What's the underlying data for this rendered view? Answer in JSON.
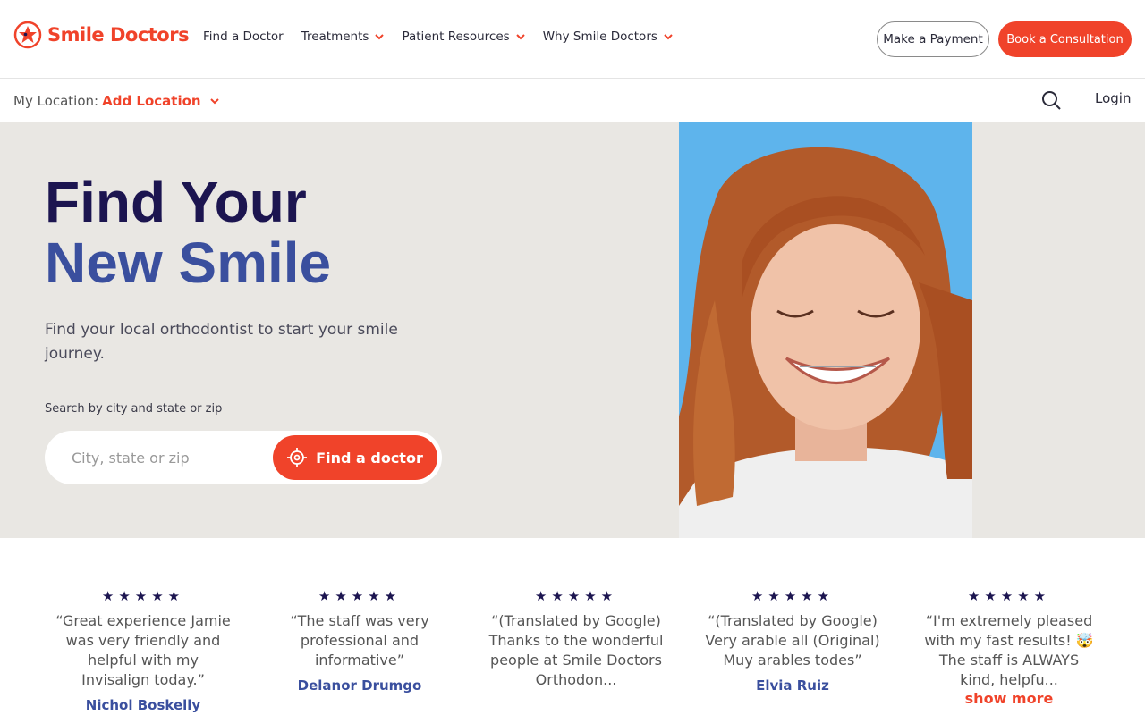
{
  "header": {
    "brand": "Smile Doctors",
    "nav": [
      {
        "label": "Find a Doctor",
        "has_dropdown": false
      },
      {
        "label": "Treatments",
        "has_dropdown": true
      },
      {
        "label": "Patient Resources",
        "has_dropdown": true
      },
      {
        "label": "Why Smile Doctors",
        "has_dropdown": true
      }
    ],
    "payment_label": "Make a Payment",
    "book_label": "Book a Consultation"
  },
  "location_bar": {
    "label": "My Location:",
    "add_label": "Add Location",
    "login_label": "Login"
  },
  "hero": {
    "title_line1": "Find Your",
    "title_line2": "New Smile",
    "subtitle": "Find your local orthodontist to start your smile journey.",
    "search_label": "Search by city and state or zip",
    "search_placeholder": "City, state or zip",
    "find_button": "Find a doctor"
  },
  "reviews": [
    {
      "stars": "★★★★★",
      "quote": "“Great experience Jamie was very friendly and helpful with my Invisalign today.”",
      "author": "Nichol Boskelly"
    },
    {
      "stars": "★★★★★",
      "quote": "“The staff was very professional and informative”",
      "author": "Delanor Drumgo"
    },
    {
      "stars": "★★★★★",
      "quote": "“(Translated by Google) Thanks to the wonderful people at Smile Doctors Orthodon...",
      "author": ""
    },
    {
      "stars": "★★★★★",
      "quote": "“(Translated by Google) Very arable all (Original) Muy arables todes”",
      "author": "Elvia Ruiz"
    },
    {
      "stars": "★★★★★",
      "quote": "“I'm extremely pleased with my fast results! 🤯The staff is ALWAYS kind, helpfu...",
      "author": "",
      "more": "show more"
    }
  ],
  "colors": {
    "brand": "#f0432a",
    "navy": "#1c1550",
    "blue": "#3a4f9e",
    "hero_bg": "#e9e7e3",
    "photo_bg": "#5eb4ec"
  }
}
